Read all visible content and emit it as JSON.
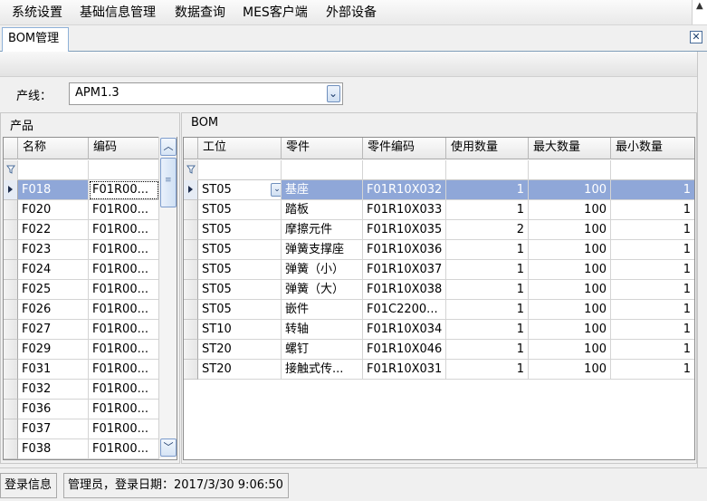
{
  "menu": [
    "系统设置",
    "基础信息管理",
    "数据查询",
    "MES客户端",
    "外部设备"
  ],
  "tab": {
    "label": "BOM管理"
  },
  "line": {
    "label": "产线：",
    "value": "APM1.3"
  },
  "products": {
    "title": "产品",
    "columns": [
      "名称",
      "编码"
    ],
    "rows": [
      [
        "F018",
        "F01R00..."
      ],
      [
        "F020",
        "F01R00..."
      ],
      [
        "F022",
        "F01R00..."
      ],
      [
        "F023",
        "F01R00..."
      ],
      [
        "F024",
        "F01R00..."
      ],
      [
        "F025",
        "F01R00..."
      ],
      [
        "F026",
        "F01R00..."
      ],
      [
        "F027",
        "F01R00..."
      ],
      [
        "F029",
        "F01R00..."
      ],
      [
        "F031",
        "F01R00..."
      ],
      [
        "F032",
        "F01R00..."
      ],
      [
        "F036",
        "F01R00..."
      ],
      [
        "F037",
        "F01R00..."
      ],
      [
        "F038",
        "F01R00..."
      ]
    ]
  },
  "bom": {
    "title": "BOM",
    "columns": [
      "工位",
      "零件",
      "零件编码",
      "使用数量",
      "最大数量",
      "最小数量"
    ],
    "rows": [
      [
        "ST05",
        "基座",
        "F01R10X032",
        "1",
        "100",
        "1"
      ],
      [
        "ST05",
        "踏板",
        "F01R10X033",
        "1",
        "100",
        "1"
      ],
      [
        "ST05",
        "摩擦元件",
        "F01R10X035",
        "2",
        "100",
        "1"
      ],
      [
        "ST05",
        "弹簧支撑座",
        "F01R10X036",
        "1",
        "100",
        "1"
      ],
      [
        "ST05",
        "弹簧（小）",
        "F01R10X037",
        "1",
        "100",
        "1"
      ],
      [
        "ST05",
        "弹簧（大）",
        "F01R10X038",
        "1",
        "100",
        "1"
      ],
      [
        "ST05",
        "嵌件",
        "F01C2200...",
        "1",
        "100",
        "1"
      ],
      [
        "ST10",
        "转轴",
        "F01R10X034",
        "1",
        "100",
        "1"
      ],
      [
        "ST20",
        "螺钉",
        "F01R10X046",
        "1",
        "100",
        "1"
      ],
      [
        "ST20",
        "接触式传...",
        "F01R10X031",
        "1",
        "100",
        "1"
      ]
    ]
  },
  "status": {
    "label": "登录信息",
    "text": "管理员，登录日期：2017/3/30 9:06:50"
  }
}
